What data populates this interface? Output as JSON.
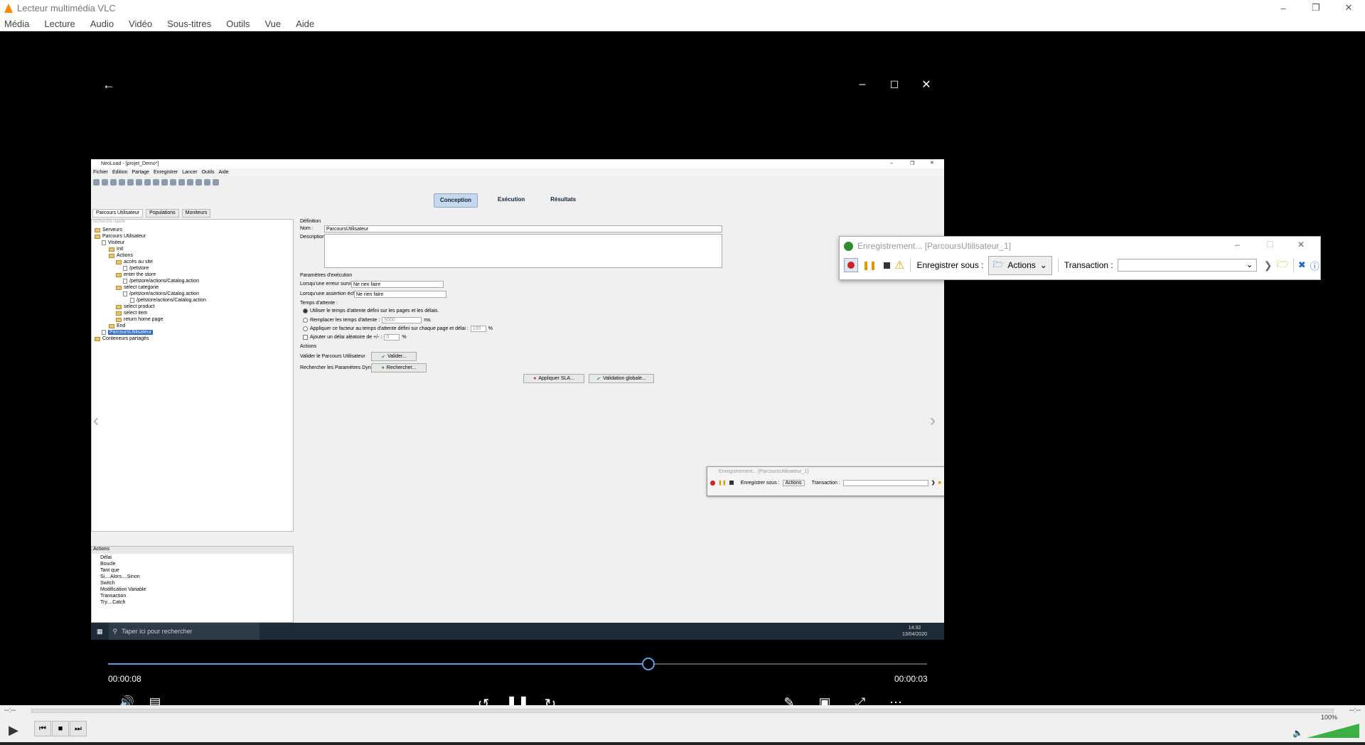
{
  "vlc": {
    "title": "Lecteur multimédia VLC",
    "menu": [
      "Média",
      "Lecture",
      "Audio",
      "Vidéo",
      "Sous-titres",
      "Outils",
      "Vue",
      "Aide"
    ],
    "time_left": "--:--",
    "time_right": "--:--",
    "volume": "100%",
    "accent": "#ff8800"
  },
  "player": {
    "elapsed": "00:00:08",
    "remaining": "00:00:03",
    "progress": 0.66,
    "skip_back": "10",
    "skip_fwd": "30"
  },
  "neoload": {
    "title": "NeoLoad - [projet_Demo*]",
    "menu": [
      "Fichier",
      "Edition",
      "Partage",
      "Enregistrer",
      "Lancer",
      "Outils",
      "Aide"
    ],
    "main_tabs": [
      "Conception",
      "Exécution",
      "Résultats"
    ],
    "left_tabs": [
      "Parcours Utilisateur",
      "Populations",
      "Moniteurs"
    ],
    "search_placeholder": "recherche rapide",
    "tree": [
      "Serveurs",
      "Parcours Utilisateur",
      "Visiteur",
      "Init",
      "Actions",
      "accès au site",
      "/petstore",
      "enter the store",
      "/petstore/actions/Catalog.action",
      "select categorie",
      "/petstore/actions/Catalog.action",
      "/petstore/actions/Catalog.action",
      "select product",
      "select item",
      "return home page",
      "End",
      "ParcoursUtilisateur",
      "Conteneurs partagés"
    ],
    "actions_title": "Actions",
    "actions_list": [
      "Délai",
      "Boucle",
      "Tant que",
      "Si....Alors....Sinon",
      "Switch",
      "Modification Variable",
      "Transaction",
      "Try....Catch"
    ],
    "definition": {
      "section": "Définition",
      "name_label": "Nom :",
      "name_value": "ParcoursUtilisateur",
      "desc_label": "Description :"
    },
    "params": {
      "section": "Paramètres d'exécution",
      "error_label": "Lorsqu'une erreur survient :",
      "error_value": "Ne rien faire",
      "assert_label": "Lorsqu'une assertion échoue :",
      "assert_value": "Ne rien faire",
      "wait_label": "Temps d'attente :",
      "opt1": "Utiliser le temps d'attente défini sur les pages et les délais.",
      "opt2": "Remplacer les temps d'attente :",
      "opt2_value": "5000",
      "opt2_unit": "ms",
      "opt3": "Appliquer ce facteur au temps d'attente défini sur chaque page et délai :",
      "opt3_value": "100",
      "opt3_unit": "%",
      "opt4": "Ajouter un délai aléatoire de +/- :",
      "opt4_value": "0",
      "opt4_unit": "%"
    },
    "actions_section": {
      "section": "Actions",
      "validate_label": "Valider le Parcours Utilisateur",
      "validate_btn": "Valider...",
      "search_label": "Rechercher les Paramètres Dynamiques",
      "search_btn": "Rechercher...",
      "sla_btn": "Appliquer SLA...",
      "global_btn": "Validation globale..."
    },
    "rec_small": {
      "title": "Enregistrement... [ParcoursUtilisateur_1]",
      "save_label": "Enregistrer sous :",
      "save_value": "Actions",
      "transaction_label": "Transaction :"
    },
    "taskbar": {
      "search": "Taper ici pour rechercher",
      "time": "14:32",
      "date": "13/04/2020"
    }
  },
  "rec_big": {
    "title": "Enregistrement... [ParcoursUtilisateur_1]",
    "save_label": "Enregistrer sous :",
    "save_value": "Actions",
    "transaction_label": "Transaction :"
  }
}
